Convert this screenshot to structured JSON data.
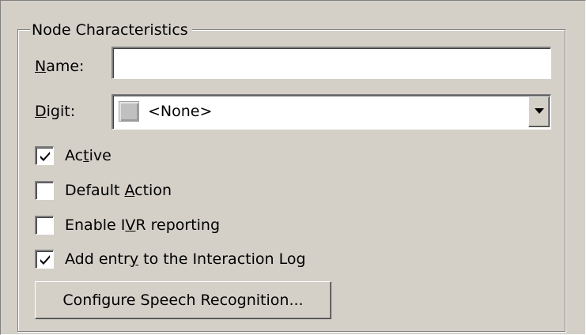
{
  "group": {
    "title": "Node Characteristics"
  },
  "name_field": {
    "label_key": "N",
    "label_rest": "ame:",
    "value": "",
    "placeholder": ""
  },
  "digit_field": {
    "label_key": "D",
    "label_rest": "igit:",
    "selected_value": "<None>",
    "swatch_icon": "grey-square-icon",
    "dropdown_icon": "chevron-down-icon"
  },
  "checkboxes": [
    {
      "pre": "Ac",
      "key": "t",
      "post": "ive",
      "checked": true
    },
    {
      "pre": "Default ",
      "key": "A",
      "post": "ction",
      "checked": false
    },
    {
      "pre": "Enable I",
      "key": "V",
      "post": "R reporting",
      "checked": false
    },
    {
      "pre": "Add entr",
      "key": "y",
      "post": " to the Interaction Log",
      "checked": true
    }
  ],
  "configure_button": {
    "label": "Configure Speech Recognition..."
  },
  "colors": {
    "dialog_bg": "#d4d0c8",
    "field_bg": "#ffffff",
    "shadow": "#808080",
    "highlight": "#ffffff"
  }
}
